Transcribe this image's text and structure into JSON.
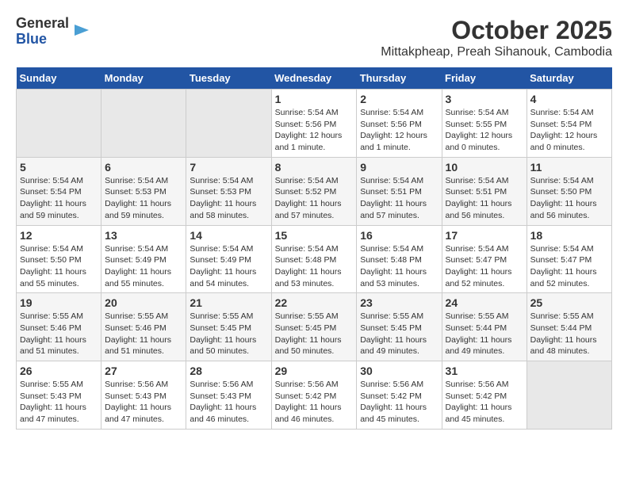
{
  "logo": {
    "line1": "General",
    "line2": "Blue"
  },
  "title": "October 2025",
  "subtitle": "Mittakpheap, Preah Sihanouk, Cambodia",
  "days_of_week": [
    "Sunday",
    "Monday",
    "Tuesday",
    "Wednesday",
    "Thursday",
    "Friday",
    "Saturday"
  ],
  "weeks": [
    [
      {
        "day": "",
        "info": ""
      },
      {
        "day": "",
        "info": ""
      },
      {
        "day": "",
        "info": ""
      },
      {
        "day": "1",
        "info": "Sunrise: 5:54 AM\nSunset: 5:56 PM\nDaylight: 12 hours\nand 1 minute."
      },
      {
        "day": "2",
        "info": "Sunrise: 5:54 AM\nSunset: 5:56 PM\nDaylight: 12 hours\nand 1 minute."
      },
      {
        "day": "3",
        "info": "Sunrise: 5:54 AM\nSunset: 5:55 PM\nDaylight: 12 hours\nand 0 minutes."
      },
      {
        "day": "4",
        "info": "Sunrise: 5:54 AM\nSunset: 5:54 PM\nDaylight: 12 hours\nand 0 minutes."
      }
    ],
    [
      {
        "day": "5",
        "info": "Sunrise: 5:54 AM\nSunset: 5:54 PM\nDaylight: 11 hours\nand 59 minutes."
      },
      {
        "day": "6",
        "info": "Sunrise: 5:54 AM\nSunset: 5:53 PM\nDaylight: 11 hours\nand 59 minutes."
      },
      {
        "day": "7",
        "info": "Sunrise: 5:54 AM\nSunset: 5:53 PM\nDaylight: 11 hours\nand 58 minutes."
      },
      {
        "day": "8",
        "info": "Sunrise: 5:54 AM\nSunset: 5:52 PM\nDaylight: 11 hours\nand 57 minutes."
      },
      {
        "day": "9",
        "info": "Sunrise: 5:54 AM\nSunset: 5:51 PM\nDaylight: 11 hours\nand 57 minutes."
      },
      {
        "day": "10",
        "info": "Sunrise: 5:54 AM\nSunset: 5:51 PM\nDaylight: 11 hours\nand 56 minutes."
      },
      {
        "day": "11",
        "info": "Sunrise: 5:54 AM\nSunset: 5:50 PM\nDaylight: 11 hours\nand 56 minutes."
      }
    ],
    [
      {
        "day": "12",
        "info": "Sunrise: 5:54 AM\nSunset: 5:50 PM\nDaylight: 11 hours\nand 55 minutes."
      },
      {
        "day": "13",
        "info": "Sunrise: 5:54 AM\nSunset: 5:49 PM\nDaylight: 11 hours\nand 55 minutes."
      },
      {
        "day": "14",
        "info": "Sunrise: 5:54 AM\nSunset: 5:49 PM\nDaylight: 11 hours\nand 54 minutes."
      },
      {
        "day": "15",
        "info": "Sunrise: 5:54 AM\nSunset: 5:48 PM\nDaylight: 11 hours\nand 53 minutes."
      },
      {
        "day": "16",
        "info": "Sunrise: 5:54 AM\nSunset: 5:48 PM\nDaylight: 11 hours\nand 53 minutes."
      },
      {
        "day": "17",
        "info": "Sunrise: 5:54 AM\nSunset: 5:47 PM\nDaylight: 11 hours\nand 52 minutes."
      },
      {
        "day": "18",
        "info": "Sunrise: 5:54 AM\nSunset: 5:47 PM\nDaylight: 11 hours\nand 52 minutes."
      }
    ],
    [
      {
        "day": "19",
        "info": "Sunrise: 5:55 AM\nSunset: 5:46 PM\nDaylight: 11 hours\nand 51 minutes."
      },
      {
        "day": "20",
        "info": "Sunrise: 5:55 AM\nSunset: 5:46 PM\nDaylight: 11 hours\nand 51 minutes."
      },
      {
        "day": "21",
        "info": "Sunrise: 5:55 AM\nSunset: 5:45 PM\nDaylight: 11 hours\nand 50 minutes."
      },
      {
        "day": "22",
        "info": "Sunrise: 5:55 AM\nSunset: 5:45 PM\nDaylight: 11 hours\nand 50 minutes."
      },
      {
        "day": "23",
        "info": "Sunrise: 5:55 AM\nSunset: 5:45 PM\nDaylight: 11 hours\nand 49 minutes."
      },
      {
        "day": "24",
        "info": "Sunrise: 5:55 AM\nSunset: 5:44 PM\nDaylight: 11 hours\nand 49 minutes."
      },
      {
        "day": "25",
        "info": "Sunrise: 5:55 AM\nSunset: 5:44 PM\nDaylight: 11 hours\nand 48 minutes."
      }
    ],
    [
      {
        "day": "26",
        "info": "Sunrise: 5:55 AM\nSunset: 5:43 PM\nDaylight: 11 hours\nand 47 minutes."
      },
      {
        "day": "27",
        "info": "Sunrise: 5:56 AM\nSunset: 5:43 PM\nDaylight: 11 hours\nand 47 minutes."
      },
      {
        "day": "28",
        "info": "Sunrise: 5:56 AM\nSunset: 5:43 PM\nDaylight: 11 hours\nand 46 minutes."
      },
      {
        "day": "29",
        "info": "Sunrise: 5:56 AM\nSunset: 5:42 PM\nDaylight: 11 hours\nand 46 minutes."
      },
      {
        "day": "30",
        "info": "Sunrise: 5:56 AM\nSunset: 5:42 PM\nDaylight: 11 hours\nand 45 minutes."
      },
      {
        "day": "31",
        "info": "Sunrise: 5:56 AM\nSunset: 5:42 PM\nDaylight: 11 hours\nand 45 minutes."
      },
      {
        "day": "",
        "info": ""
      }
    ]
  ]
}
